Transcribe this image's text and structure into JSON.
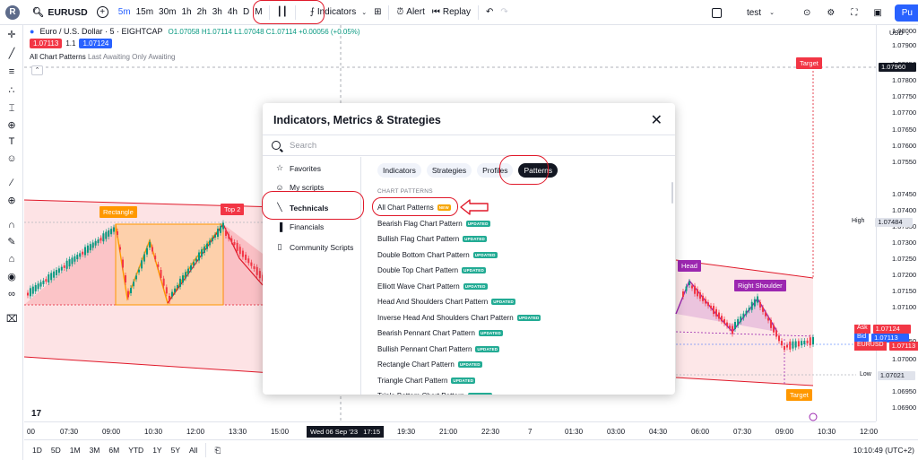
{
  "topbar": {
    "logo_letter": "R",
    "symbol": "EURUSD",
    "intervals": [
      "5m",
      "15m",
      "30m",
      "1h",
      "2h",
      "3h",
      "4h",
      "D",
      "M"
    ],
    "active_interval": "5m",
    "indicators_label": "Indicators",
    "alert_label": "Alert",
    "replay_label": "Replay",
    "layout_name": "test",
    "publish_label": "Pu"
  },
  "legend": {
    "title": "Euro / U.S. Dollar · 5 · EIGHTCAP",
    "ohlc": "O1.07058 H1.07114 L1.07048 C1.07114 +0.00056 (+0.05%)",
    "sell_price": "1.07113",
    "spread": "1.1",
    "buy_price": "1.07124",
    "indicator_name": "All Chart Patterns",
    "indicator_args": "Last Awaiting Only Awaiting"
  },
  "chart_labels": {
    "rectangle": "Rectangle",
    "top2": "Top 2",
    "head": "Head",
    "right_shoulder": "Right Shoulder",
    "target_top": "Target",
    "target_bottom": "Target"
  },
  "price_axis": {
    "currency": "USD",
    "ticks": [
      "1.08000",
      "1.07900",
      "1.07850",
      "1.07800",
      "1.07750",
      "1.07700",
      "1.07650",
      "1.07600",
      "1.07550",
      "1.07450",
      "1.07400",
      "1.07350",
      "1.07300",
      "1.07250",
      "1.07200",
      "1.07150",
      "1.07100",
      "1.07050",
      "1.07000",
      "1.06950",
      "1.06900"
    ],
    "crosshair_price": "1.07960",
    "high_label": "High",
    "high_price": "1.07484",
    "ask_label": "Ask",
    "ask_price": "1.07124",
    "bid_label": "Bid",
    "bid_price": "1.07113",
    "sym_label": "EURUSD",
    "sym_price": "1.07113",
    "low_label": "Low",
    "low_price": "1.07021"
  },
  "time_axis": {
    "ticks": [
      "00",
      "07:30",
      "09:00",
      "10:30",
      "12:00",
      "13:30",
      "15:00",
      "18:00",
      "19:30",
      "21:00",
      "22:30",
      "7",
      "01:30",
      "03:00",
      "04:30",
      "06:00",
      "07:30",
      "09:00",
      "10:30",
      "12:00"
    ],
    "crosshair_time": "Wed 06 Sep '23   17:15"
  },
  "bottombar": {
    "ranges": [
      "1D",
      "5D",
      "1M",
      "3M",
      "6M",
      "YTD",
      "1Y",
      "5Y",
      "All"
    ],
    "clock": "10:10:49 (UTC+2)"
  },
  "dialog": {
    "title": "Indicators, Metrics & Strategies",
    "search_placeholder": "Search",
    "sidebar": [
      {
        "label": "Favorites",
        "icon": "star-icon"
      },
      {
        "label": "My scripts",
        "icon": "user-icon"
      },
      {
        "label": "Technicals",
        "icon": "chart-line-icon"
      },
      {
        "label": "Financials",
        "icon": "bar-chart-icon"
      },
      {
        "label": "Community Scripts",
        "icon": "book-icon"
      }
    ],
    "active_sidebar": "Technicals",
    "tabs": [
      "Indicators",
      "Strategies",
      "Profiles",
      "Patterns"
    ],
    "active_tab": "Patterns",
    "list_header": "CHART PATTERNS",
    "items": [
      {
        "label": "All Chart Patterns",
        "badge": "NEW"
      },
      {
        "label": "Bearish Flag Chart Pattern",
        "badge": "UPDATED"
      },
      {
        "label": "Bullish Flag Chart Pattern",
        "badge": "UPDATED"
      },
      {
        "label": "Double Bottom Chart Pattern",
        "badge": "UPDATED"
      },
      {
        "label": "Double Top Chart Pattern",
        "badge": "UPDATED"
      },
      {
        "label": "Elliott Wave Chart Pattern",
        "badge": "UPDATED"
      },
      {
        "label": "Head And Shoulders Chart Pattern",
        "badge": "UPDATED"
      },
      {
        "label": "Inverse Head And Shoulders Chart Pattern",
        "badge": "UPDATED"
      },
      {
        "label": "Bearish Pennant Chart Pattern",
        "badge": "UPDATED"
      },
      {
        "label": "Bullish Pennant Chart Pattern",
        "badge": "UPDATED"
      },
      {
        "label": "Rectangle Chart Pattern",
        "badge": "UPDATED"
      },
      {
        "label": "Triangle Chart Pattern",
        "badge": "UPDATED"
      },
      {
        "label": "Triple Bottom Chart Pattern",
        "badge": "UPDATED"
      }
    ]
  },
  "colors": {
    "accent": "#2962ff",
    "up": "#089981",
    "down": "#f23645",
    "pattern_orange": "#ff9800",
    "pattern_purple": "#9c27b0",
    "annotation_red": "#e0192a"
  }
}
